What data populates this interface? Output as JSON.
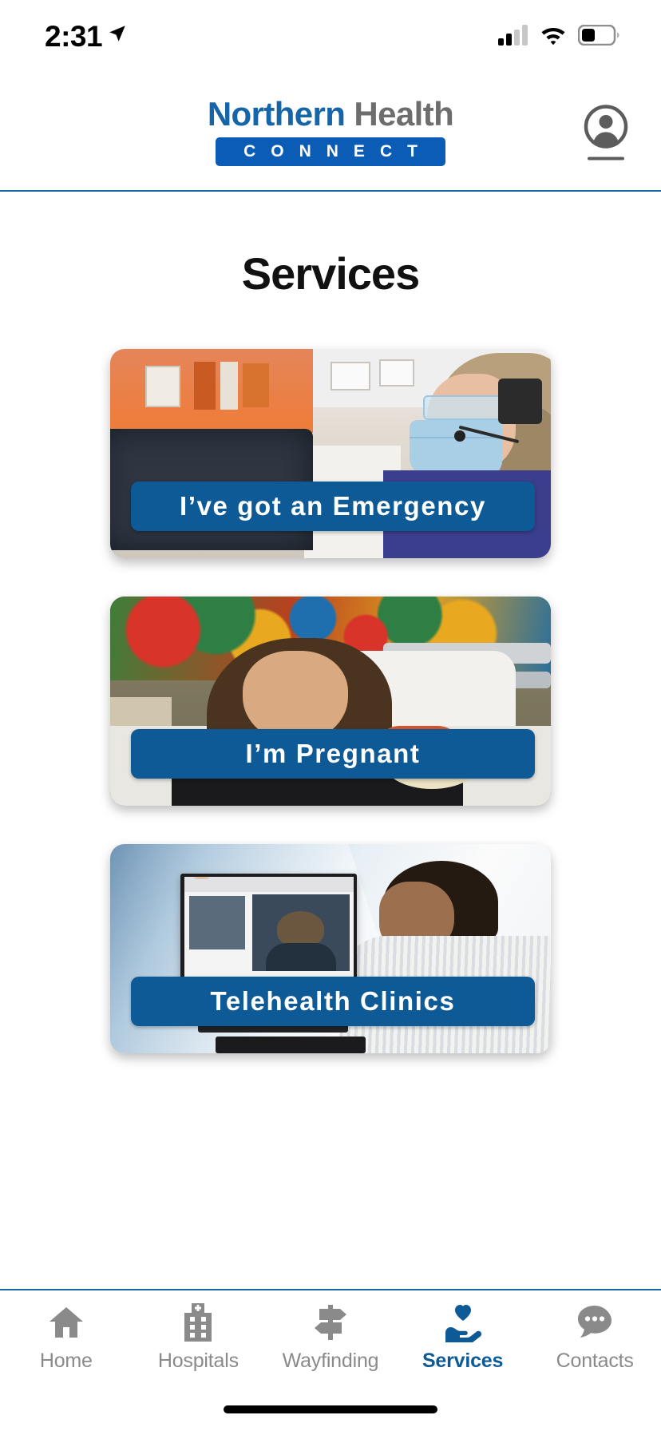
{
  "status_bar": {
    "time": "2:31",
    "location_icon": "location-arrow-icon",
    "cellular_icon": "cellular-signal-icon",
    "cellular_bars_filled": 2,
    "cellular_bars_total": 4,
    "wifi_icon": "wifi-icon",
    "battery_icon": "battery-icon",
    "battery_level_percent": 35
  },
  "header": {
    "logo": {
      "primary": "Northern",
      "secondary": "Health",
      "banner": "CONNECT",
      "banner_letters": [
        "C",
        "O",
        "N",
        "N",
        "E",
        "C",
        "T"
      ],
      "primary_color": "#1565a8",
      "secondary_color": "#6d6d6d",
      "banner_color": "#0b5cb5"
    },
    "account_button": {
      "icon": "account-circle-icon",
      "label": "Account"
    }
  },
  "main": {
    "title": "Services",
    "cards": [
      {
        "id": "emergency",
        "label": "I’ve got an Emergency",
        "image_alt": "Healthcare worker wearing a face mask and headset at a computer workstation",
        "label_color": "#0e5a96"
      },
      {
        "id": "pregnant",
        "label": "I’m Pregnant",
        "image_alt": "Woman resting in a hospital bed holding a newborn baby",
        "label_color": "#0e5a96"
      },
      {
        "id": "telehealth",
        "label": "Telehealth Clinics",
        "image_alt": "Man seated at a desktop monitor during a video consultation",
        "label_color": "#0e5a96"
      }
    ]
  },
  "bottom_nav": {
    "active_id": "services",
    "active_color": "#0e5a96",
    "inactive_color": "#8a8a8a",
    "items": [
      {
        "id": "home",
        "label": "Home",
        "icon": "home-icon"
      },
      {
        "id": "hospitals",
        "label": "Hospitals",
        "icon": "hospital-building-icon"
      },
      {
        "id": "wayfinding",
        "label": "Wayfinding",
        "icon": "signpost-icon"
      },
      {
        "id": "services",
        "label": "Services",
        "icon": "hand-heart-icon"
      },
      {
        "id": "contacts",
        "label": "Contacts",
        "icon": "chat-bubble-icon"
      }
    ]
  }
}
